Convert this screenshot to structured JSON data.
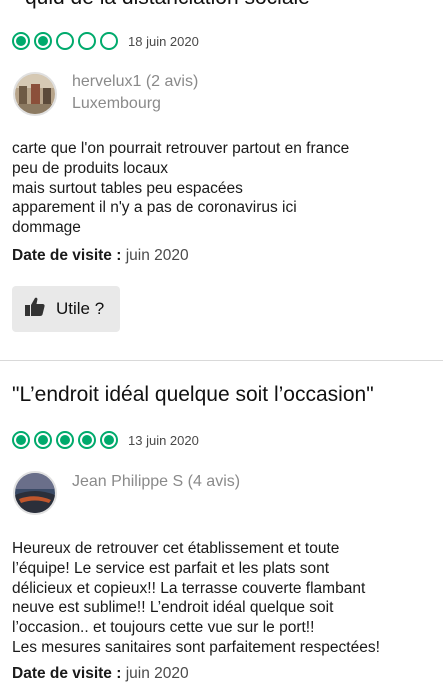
{
  "colors": {
    "rating_green": "#00aa6c",
    "muted_text": "#8a8a8a",
    "button_bg": "#e9e9e9"
  },
  "review1": {
    "title_partial": "“quid de la distanciation sociale”",
    "rating": 2,
    "rating_max": 5,
    "date": "18 juin 2020",
    "author": "hervelux1 (2 avis)",
    "location": "Luxembourg",
    "body_lines": [
      "carte que l'on pourrait retrouver partout en france",
      "peu de produits locaux",
      "mais surtout tables peu espacées",
      "apparement il n'y a pas de coronavirus ici",
      "dommage"
    ],
    "visit_label": "Date de visite :",
    "visit_value": "juin 2020",
    "useful_label": "Utile ?",
    "useful_icon": "thumbs-up-icon"
  },
  "review2": {
    "title": "\"L’endroit idéal quelque soit l’occasion\"",
    "rating": 5,
    "rating_max": 5,
    "date": "13 juin 2020",
    "author": "Jean Philippe S (4 avis)",
    "body_lines": [
      "Heureux de retrouver cet établissement et toute",
      "l’équipe! Le service est parfait et les plats sont",
      "délicieux et copieux!! La terrasse couverte flambant",
      "neuve est sublime!!  L’endroit idéal quelque soit",
      "l’occasion.. et toujours cette vue sur le port!!",
      "Les mesures sanitaires sont parfaitement respectées!"
    ],
    "visit_label": "Date de visite :",
    "visit_value": "juin 2020"
  }
}
